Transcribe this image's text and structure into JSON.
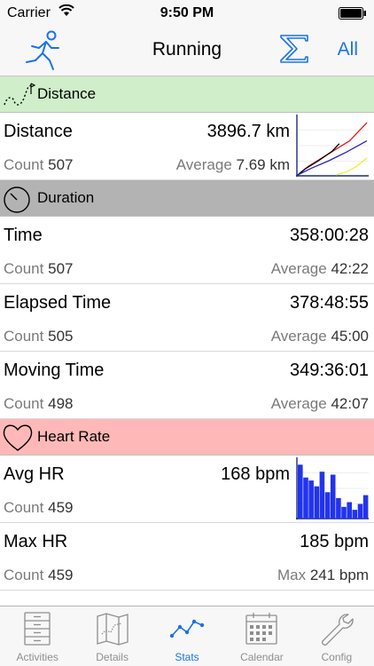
{
  "status_bar": {
    "carrier": "Carrier",
    "time": "9:50 PM"
  },
  "nav": {
    "title": "Running",
    "all_label": "All"
  },
  "sections": {
    "distance": {
      "title": "Distance"
    },
    "duration": {
      "title": "Duration"
    },
    "heart_rate": {
      "title": "Heart Rate"
    }
  },
  "rows": {
    "distance": {
      "name": "Distance",
      "value": "3896.7 km",
      "count_label": "Count",
      "count": "507",
      "avg_label": "Average",
      "avg": "7.69 km"
    },
    "time": {
      "name": "Time",
      "value": "358:00:28",
      "count_label": "Count",
      "count": "507",
      "avg_label": "Average",
      "avg": "42:22"
    },
    "elapsed": {
      "name": "Elapsed Time",
      "value": "378:48:55",
      "count_label": "Count",
      "count": "505",
      "avg_label": "Average",
      "avg": "45:00"
    },
    "moving": {
      "name": "Moving Time",
      "value": "349:36:01",
      "count_label": "Count",
      "count": "498",
      "avg_label": "Average",
      "avg": "42:07"
    },
    "avg_hr": {
      "name": "Avg HR",
      "value": "168 bpm",
      "count_label": "Count",
      "count": "459"
    },
    "max_hr": {
      "name": "Max HR",
      "value": "185 bpm",
      "count_label": "Count",
      "count": "459",
      "avg_label": "Max",
      "avg": "241 bpm"
    }
  },
  "tabs": [
    {
      "label": "Activities",
      "icon": "cabinet-icon"
    },
    {
      "label": "Details",
      "icon": "map-icon"
    },
    {
      "label": "Stats",
      "icon": "stats-line-icon",
      "active": true
    },
    {
      "label": "Calendar",
      "icon": "calendar-icon"
    },
    {
      "label": "Config",
      "icon": "wrench-icon"
    }
  ],
  "colors": {
    "accent": "#1a73e8",
    "distance_header": "#cfeec9",
    "duration_header": "#b3b3b3",
    "hr_header": "#ffb8b8",
    "hist_bar": "#2233ee"
  },
  "distance_trend": {
    "series": [
      {
        "color": "#e41a1c",
        "points": [
          [
            0,
            0
          ],
          [
            0.15,
            0.15
          ],
          [
            0.35,
            0.3
          ],
          [
            0.55,
            0.45
          ],
          [
            0.75,
            0.6
          ],
          [
            1,
            0.92
          ]
        ]
      },
      {
        "color": "#000000",
        "points": [
          [
            0,
            0
          ],
          [
            0.1,
            0.1
          ],
          [
            0.3,
            0.25
          ],
          [
            0.5,
            0.42
          ],
          [
            0.6,
            0.55
          ]
        ]
      },
      {
        "color": "#2222cc",
        "points": [
          [
            0,
            0
          ],
          [
            0.2,
            0.12
          ],
          [
            0.45,
            0.25
          ],
          [
            0.7,
            0.4
          ],
          [
            1,
            0.6
          ]
        ]
      },
      {
        "color": "#eeee33",
        "points": [
          [
            0.55,
            0
          ],
          [
            0.7,
            0.05
          ],
          [
            0.85,
            0.15
          ],
          [
            1,
            0.3
          ]
        ]
      }
    ]
  },
  "hr_histogram": {
    "values": [
      0.92,
      0.7,
      0.65,
      0.55,
      0.8,
      0.45,
      0.75,
      0.35,
      0.2,
      0.28,
      0.15,
      0.25,
      0.4
    ]
  }
}
